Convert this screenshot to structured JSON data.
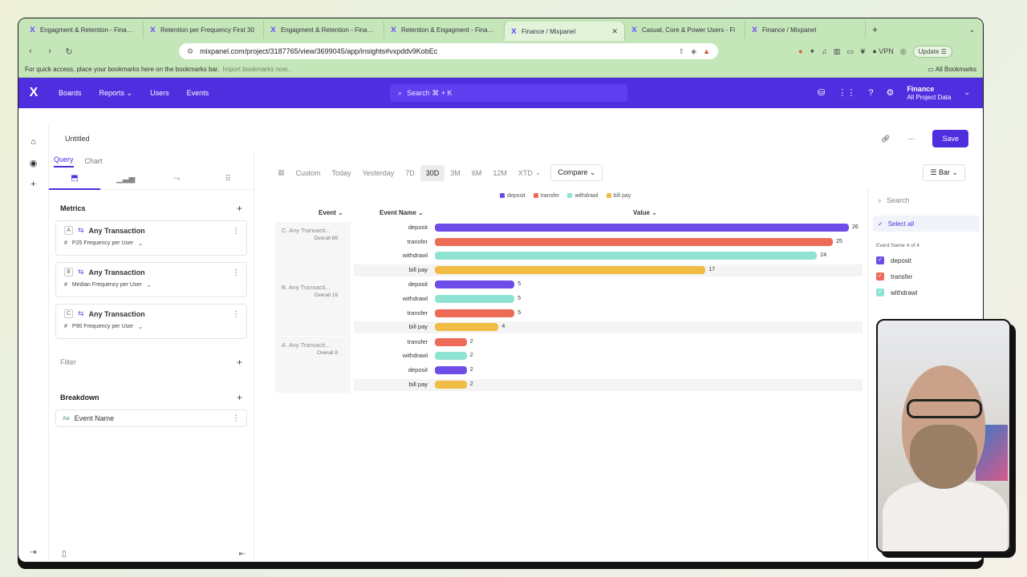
{
  "browser": {
    "tabs": [
      {
        "label": "Engagment & Retention - Finance",
        "active": false
      },
      {
        "label": "Retention per Frequency First 30",
        "active": false
      },
      {
        "label": "Engagment & Retention - Finance",
        "active": false
      },
      {
        "label": "Retention & Engagment - Finance",
        "active": false
      },
      {
        "label": "Finance / Mixpanel",
        "active": true
      },
      {
        "label": "Casual, Core & Power Users - Fi",
        "active": false
      },
      {
        "label": "Finance / Mixpanel",
        "active": false
      }
    ],
    "url": "mixpanel.com/project/3187765/view/3699045/app/insights#vxpddv9KobEc",
    "vpn_label": "VPN",
    "update_label": "Update",
    "bookmarks_hint": "For quick access, place your bookmarks here on the bookmarks bar.",
    "import_link": "Import bookmarks now...",
    "all_bookmarks": "All Bookmarks"
  },
  "appnav": {
    "logo": "X",
    "links": [
      "Boards",
      "Reports",
      "Users",
      "Events"
    ],
    "search_placeholder": "Search ⌘ + K",
    "project_name": "Finance",
    "project_sub": "All Project Data"
  },
  "report": {
    "title": "Untitled",
    "save_label": "Save"
  },
  "left_panel": {
    "tabs": [
      "Query",
      "Chart"
    ],
    "metrics_label": "Metrics",
    "metrics": [
      {
        "letter": "A",
        "name": "Any Transaction",
        "measure": "P25 Frequency per User"
      },
      {
        "letter": "B",
        "name": "Any Transaction",
        "measure": "Median Frequency per User"
      },
      {
        "letter": "C",
        "name": "Any Transaction",
        "measure": "P90 Frequency per User"
      }
    ],
    "filter_label": "Filter",
    "breakdown_label": "Breakdown",
    "breakdown_item": "Event Name",
    "breakdown_type": "Aa"
  },
  "controls": {
    "ranges": [
      "Custom",
      "Today",
      "Yesterday",
      "7D",
      "30D",
      "3M",
      "6M",
      "12M",
      "XTD"
    ],
    "active_range": "30D",
    "compare_label": "Compare",
    "chart_type_label": "Bar"
  },
  "chart_headers": {
    "event": "Event",
    "event_name": "Event Name",
    "value": "Value"
  },
  "chart_data": {
    "type": "bar",
    "orientation": "horizontal",
    "legend": [
      {
        "name": "deposit",
        "color": "#6d4ce8"
      },
      {
        "name": "transfer",
        "color": "#ec6a56"
      },
      {
        "name": "withdrawl",
        "color": "#8fe3d2"
      },
      {
        "name": "bill pay",
        "color": "#f0bc44"
      }
    ],
    "xlim": [
      0,
      26
    ],
    "groups": [
      {
        "title": "C. Any Transacti...",
        "overall": "Overall 89",
        "rows": [
          {
            "label": "deposit",
            "value": 26
          },
          {
            "label": "transfer",
            "value": 25
          },
          {
            "label": "withdrawl",
            "value": 24
          },
          {
            "label": "bill pay",
            "value": 17
          }
        ]
      },
      {
        "title": "B. Any Transacti...",
        "overall": "Overall 18",
        "rows": [
          {
            "label": "deposit",
            "value": 5
          },
          {
            "label": "withdrawl",
            "value": 5
          },
          {
            "label": "transfer",
            "value": 5
          },
          {
            "label": "bill pay",
            "value": 4
          }
        ]
      },
      {
        "title": "A. Any Transacti...",
        "overall": "Overall 8",
        "rows": [
          {
            "label": "transfer",
            "value": 2
          },
          {
            "label": "withdrawl",
            "value": 2
          },
          {
            "label": "deposit",
            "value": 2
          },
          {
            "label": "bill pay",
            "value": 2
          }
        ]
      }
    ]
  },
  "right_panel": {
    "search_placeholder": "Search",
    "select_all": "Select all",
    "count_label": "Event Name 4 of 4",
    "items": [
      "deposit",
      "transfer",
      "withdrawl"
    ]
  },
  "icons": {
    "home": "home-icon",
    "explore": "compass-icon",
    "add": "plus-icon"
  }
}
